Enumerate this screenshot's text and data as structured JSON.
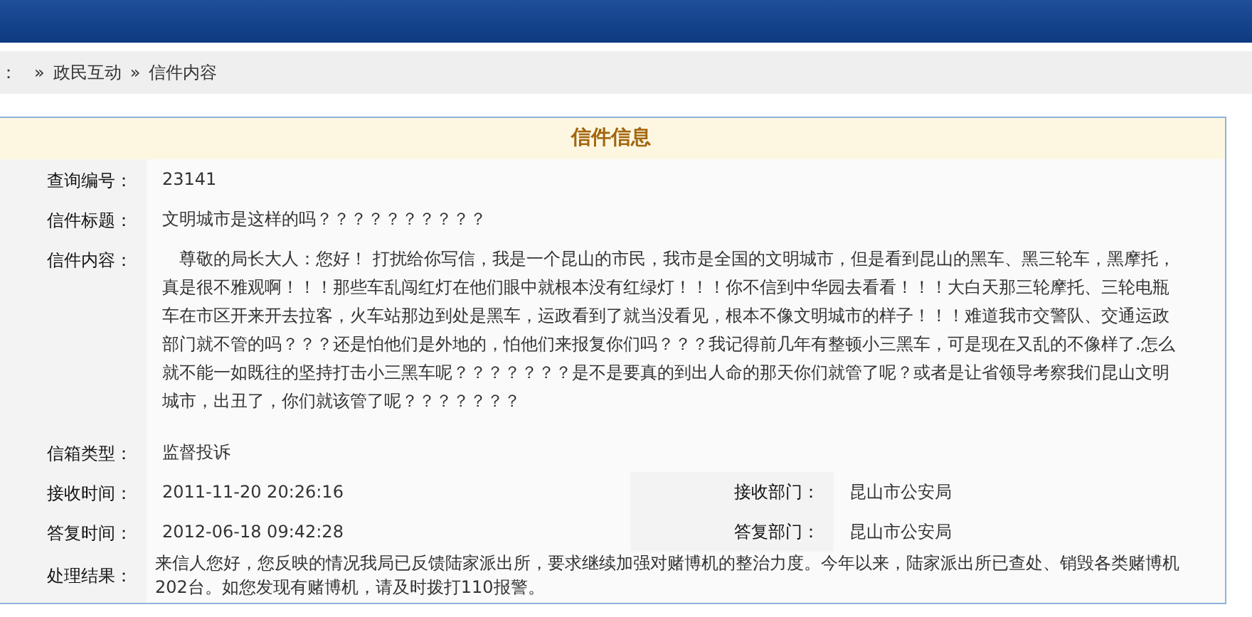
{
  "breadcrumb": [
    "：",
    "»",
    "政民互动",
    "»",
    "信件内容"
  ],
  "panel": {
    "title": "信件信息",
    "fields": [
      {
        "kind": "single",
        "label": "查询编号：",
        "value": "23141"
      },
      {
        "kind": "single",
        "label": "信件标题：",
        "value": "文明城市是这样的吗？？？？？？？？？？"
      },
      {
        "kind": "paragraph",
        "label": "信件内容：",
        "value": "尊敬的局长大人：您好！ 打扰给你写信，我是一个昆山的市民，我市是全国的文明城市，但是看到昆山的黑车、黑三轮车，黑摩托，真是很不雅观啊！！！那些车乱闯红灯在他们眼中就根本没有红绿灯！！！你不信到中华园去看看！！！大白天那三轮摩托、三轮电瓶车在市区开来开去拉客，火车站那边到处是黑车，运政看到了就当没看见，根本不像文明城市的样子！！！难道我市交警队、交通运政部门就不管的吗？？？还是怕他们是外地的，怕他们来报复你们吗？？？我记得前几年有整顿小三黑车，可是现在又乱的不像样了.怎么就不能一如既往的坚持打击小三黑车呢？？？？？？？是不是要真的到出人命的那天你们就管了呢？或者是让省领导考察我们昆山文明城市，出丑了，你们就该管了呢？？？？？？？"
      },
      {
        "kind": "single",
        "label": "信箱类型：",
        "value": "监督投诉"
      },
      {
        "kind": "pair",
        "label": "接收时间：",
        "value": "2011-11-20 20:26:16",
        "right_label": "接收部门：",
        "right_value": "昆山市公安局"
      },
      {
        "kind": "pair",
        "label": "答复时间：",
        "value": "2012-06-18 09:42:28",
        "right_label": "答复部门：",
        "right_value": "昆山市公安局"
      },
      {
        "kind": "result",
        "label": "处理结果：",
        "value": "来信人您好，您反映的情况我局已反馈陆家派出所，要求继续加强对赌博机的整治力度。今年以来，陆家派出所已查处、销毁各类赌博机202台。如您发现有赌博机，请及时拨打110报警。"
      }
    ]
  }
}
